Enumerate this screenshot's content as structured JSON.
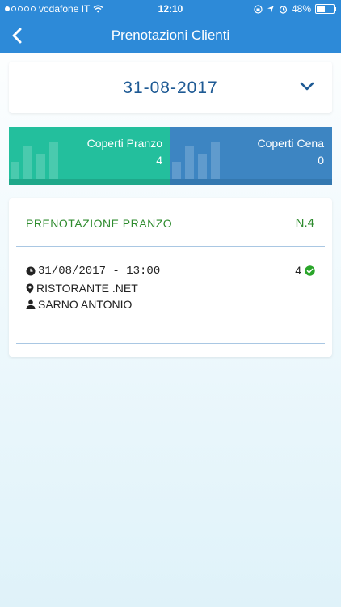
{
  "status_bar": {
    "carrier": "vodafone IT",
    "time": "12:10",
    "battery": "48%",
    "battery_level": 0.48
  },
  "nav": {
    "title": "Prenotazioni Clienti"
  },
  "date_selector": {
    "value": "31-08-2017"
  },
  "stats": {
    "lunch": {
      "label": "Coperti Pranzo",
      "value": "4"
    },
    "dinner": {
      "label": "Coperti Cena",
      "value": "0"
    }
  },
  "booking_section": {
    "title": "PRENOTAZIONE PRANZO",
    "count": "N.4",
    "items": [
      {
        "datetime": "31/08/2017 - 13:00",
        "place": "RISTORANTE .NET",
        "customer": "SARNO ANTONIO",
        "covers": "4"
      }
    ]
  },
  "colors": {
    "header": "#2d8ad8",
    "lunch": "#23bf9d",
    "dinner": "#3d85c2",
    "accent_green": "#2e8b2e",
    "date_text": "#1e5a94"
  }
}
